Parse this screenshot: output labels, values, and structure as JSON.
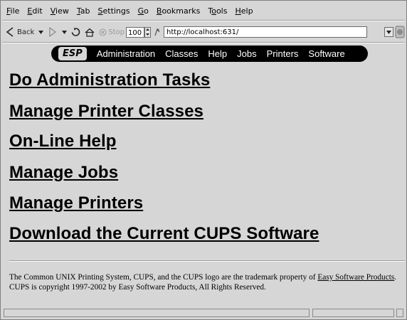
{
  "menubar": {
    "items": [
      {
        "pre": "",
        "u": "F",
        "post": "ile"
      },
      {
        "pre": "",
        "u": "E",
        "post": "dit"
      },
      {
        "pre": "",
        "u": "V",
        "post": "iew"
      },
      {
        "pre": "",
        "u": "T",
        "post": "ab"
      },
      {
        "pre": "",
        "u": "S",
        "post": "ettings"
      },
      {
        "pre": "",
        "u": "G",
        "post": "o"
      },
      {
        "pre": "",
        "u": "B",
        "post": "ookmarks"
      },
      {
        "pre": "T",
        "u": "o",
        "post": "ols"
      },
      {
        "pre": "",
        "u": "H",
        "post": "elp"
      }
    ]
  },
  "toolbar": {
    "back_label": "Back",
    "stop_label": "Stop",
    "zoom_value": "100",
    "url": "http://localhost:631/"
  },
  "cups_nav": {
    "brand": "ESP",
    "links": [
      "Administration",
      "Classes",
      "Help",
      "Jobs",
      "Printers",
      "Software"
    ]
  },
  "tasks": [
    "Do Administration Tasks",
    "Manage Printer Classes",
    "On-Line Help",
    "Manage Jobs",
    "Manage Printers",
    "Download the Current CUPS Software"
  ],
  "footer": {
    "text_before_link": "The Common UNIX Printing System, CUPS, and the CUPS logo are the trademark property of ",
    "link_text": "Easy Software Products",
    "text_after_link": ". CUPS is copyright 1997-2002 by Easy Software Products, All Rights Reserved."
  },
  "colors": {
    "background": "#d6d6d6",
    "nav_bar": "#000000",
    "nav_text": "#ffffff"
  },
  "icons": [
    "back-arrow-icon",
    "dropdown-triangle-icon",
    "forward-arrow-icon",
    "reload-icon",
    "home-icon",
    "stop-icon",
    "location-icon",
    "go-icon"
  ]
}
